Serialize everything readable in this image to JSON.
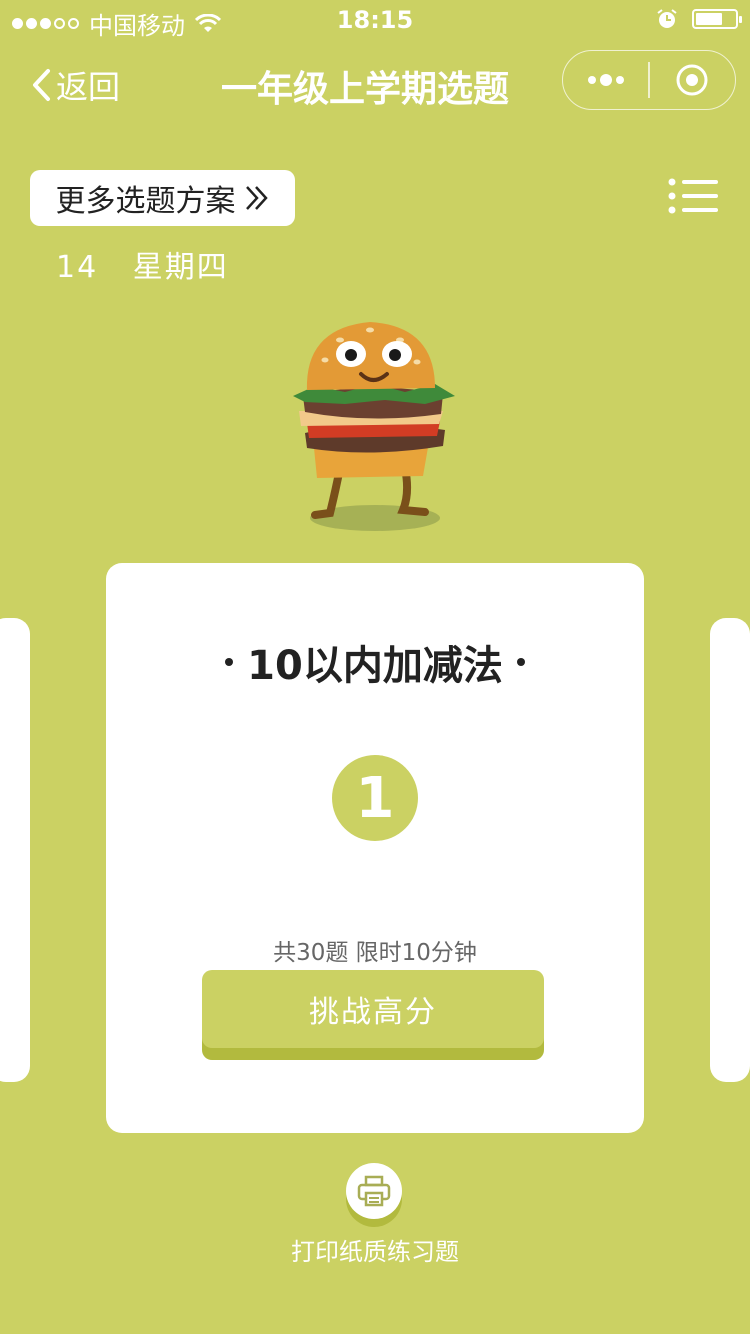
{
  "status_bar": {
    "carrier": "中国移动",
    "time": "18:15",
    "signal_filled": 3,
    "signal_total": 5,
    "battery_level": 0.6
  },
  "nav": {
    "back_label": "返回",
    "title": "一年级上学期选题"
  },
  "toolbar": {
    "more_plans_label": "更多选题方案"
  },
  "date": {
    "day": "14",
    "weekday": "星期四"
  },
  "card": {
    "title": "10以内加减法",
    "number": "1",
    "info": "共30题 限时10分钟",
    "challenge_label": "挑战高分"
  },
  "print": {
    "label": "打印纸质练习题"
  },
  "colors": {
    "background": "#cbd163",
    "accent": "#cbd163",
    "accent_dark": "#b2ba3e",
    "card": "#ffffff"
  },
  "icons": {
    "back": "chevron-left-icon",
    "menu": "more-dots-icon",
    "close": "target-icon",
    "more_plans": "double-chevron-right-icon",
    "list": "list-icon",
    "print": "printer-icon",
    "mascot": "burger-mascot"
  }
}
